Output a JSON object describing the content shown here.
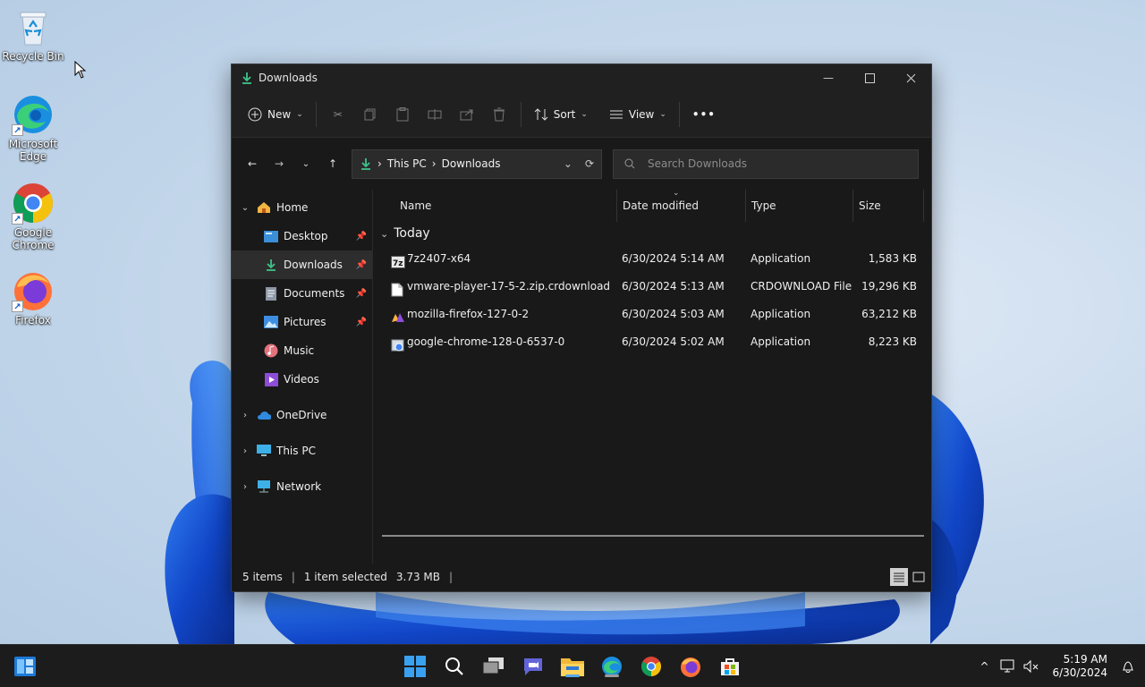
{
  "desktop": {
    "icons": [
      {
        "label": "Recycle Bin"
      },
      {
        "label": "Microsoft Edge"
      },
      {
        "label": "Google Chrome"
      },
      {
        "label": "Firefox"
      }
    ]
  },
  "window": {
    "title": "Downloads",
    "toolbar": {
      "new_label": "New",
      "sort_label": "Sort",
      "view_label": "View",
      "more_label": "•••"
    },
    "address": {
      "crumbs": [
        "This PC",
        "Downloads"
      ]
    },
    "search": {
      "placeholder": "Search Downloads"
    },
    "nav": {
      "home": "Home",
      "quick": [
        {
          "label": "Desktop",
          "pinned": true
        },
        {
          "label": "Downloads",
          "pinned": true
        },
        {
          "label": "Documents",
          "pinned": true
        },
        {
          "label": "Pictures",
          "pinned": true
        },
        {
          "label": "Music",
          "pinned": false
        },
        {
          "label": "Videos",
          "pinned": false
        }
      ],
      "onedrive": "OneDrive",
      "thispc": "This PC",
      "network": "Network"
    },
    "columns": {
      "name": "Name",
      "date": "Date modified",
      "type": "Type",
      "size": "Size"
    },
    "group": "Today",
    "files": [
      {
        "name": "7z2407-x64",
        "date": "6/30/2024 5:14 AM",
        "type": "Application",
        "size": "1,583 KB",
        "icon": "7zip-icon"
      },
      {
        "name": "vmware-player-17-5-2.zip.crdownload",
        "date": "6/30/2024 5:13 AM",
        "type": "CRDOWNLOAD File",
        "size": "19,296 KB",
        "icon": "file-icon"
      },
      {
        "name": "mozilla-firefox-127-0-2",
        "date": "6/30/2024 5:03 AM",
        "type": "Application",
        "size": "63,212 KB",
        "icon": "firefox-installer-icon"
      },
      {
        "name": "google-chrome-128-0-6537-0",
        "date": "6/30/2024 5:02 AM",
        "type": "Application",
        "size": "8,223 KB",
        "icon": "chrome-installer-icon"
      }
    ],
    "status": {
      "items": "5 items",
      "selected": "1 item selected",
      "size": "3.73 MB",
      "separator": "|"
    }
  },
  "taskbar": {
    "clock_time": "5:19 AM",
    "clock_date": "6/30/2024"
  },
  "colors": {
    "accent": "#58a8e8",
    "window_bg": "#191919",
    "toolbar_bg": "#202020",
    "taskbar_bg": "#1c1c1c"
  }
}
